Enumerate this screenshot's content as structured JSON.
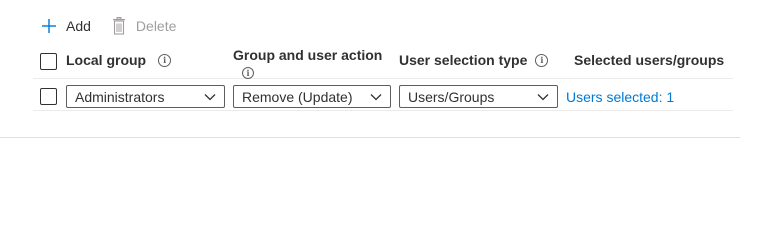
{
  "toolbar": {
    "add_label": "Add",
    "delete_label": "Delete"
  },
  "table": {
    "columns": [
      {
        "label": "Local group",
        "info": true
      },
      {
        "label": "Group and user action",
        "info": true
      },
      {
        "label": "User selection type",
        "info": true
      },
      {
        "label": "Selected users/groups",
        "info": false
      }
    ],
    "rows": [
      {
        "local_group": "Administrators",
        "action": "Remove (Update)",
        "selection_type": "Users/Groups",
        "selected_link": "Users selected: 1"
      }
    ]
  },
  "colors": {
    "link": "#0078d4",
    "add_icon": "#0078d4",
    "disabled": "#a19f9d"
  },
  "icons": {
    "add": "plus-icon",
    "delete": "trash-icon",
    "info": "info-icon",
    "dropdown": "chevron-down-icon"
  }
}
